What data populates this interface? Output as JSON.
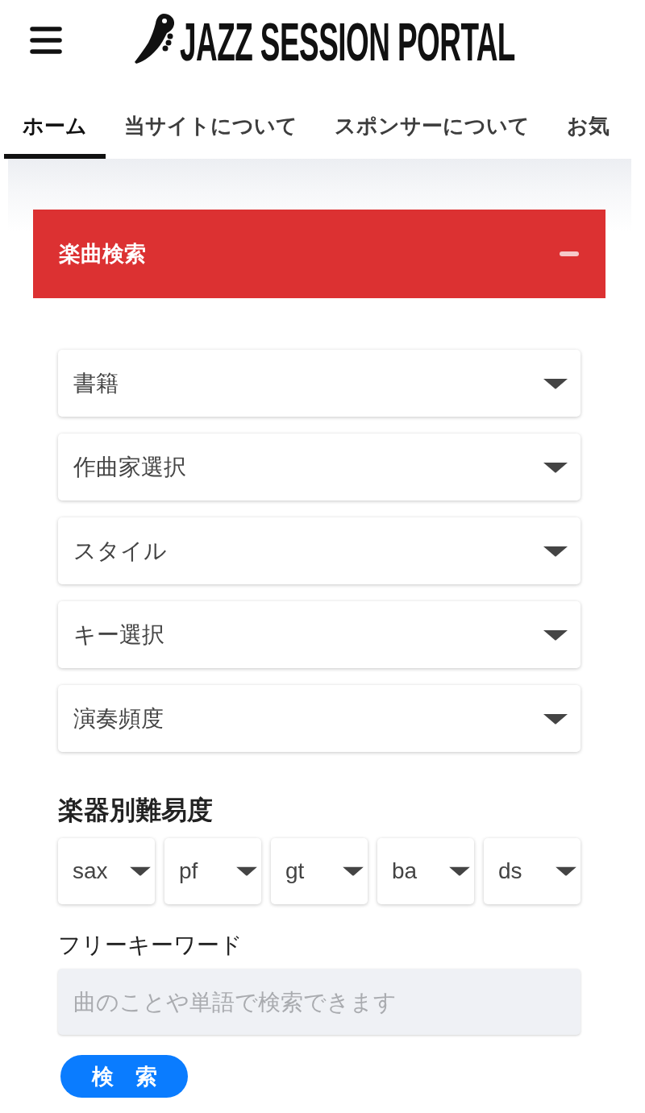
{
  "header": {
    "title": "JAZZ SESSION PORTAL"
  },
  "tabs": [
    {
      "label": "ホーム",
      "selected": true
    },
    {
      "label": "当サイトについて",
      "selected": false
    },
    {
      "label": "スポンサーについて",
      "selected": false
    },
    {
      "label": "お気",
      "selected": false
    }
  ],
  "search_panel": {
    "title": "楽曲検索",
    "expanded": true,
    "dropdowns": [
      {
        "label": "書籍"
      },
      {
        "label": "作曲家選択"
      },
      {
        "label": "スタイル"
      },
      {
        "label": "キー選択"
      },
      {
        "label": "演奏頻度"
      }
    ],
    "difficulty": {
      "heading": "楽器別難易度",
      "selects": [
        {
          "label": "sax"
        },
        {
          "label": "pf"
        },
        {
          "label": "gt"
        },
        {
          "label": "ba"
        },
        {
          "label": "ds"
        }
      ]
    },
    "keyword": {
      "label": "フリーキーワード",
      "placeholder": "曲のことや単語で検索できます"
    },
    "search_button": {
      "label": "検　索"
    }
  }
}
